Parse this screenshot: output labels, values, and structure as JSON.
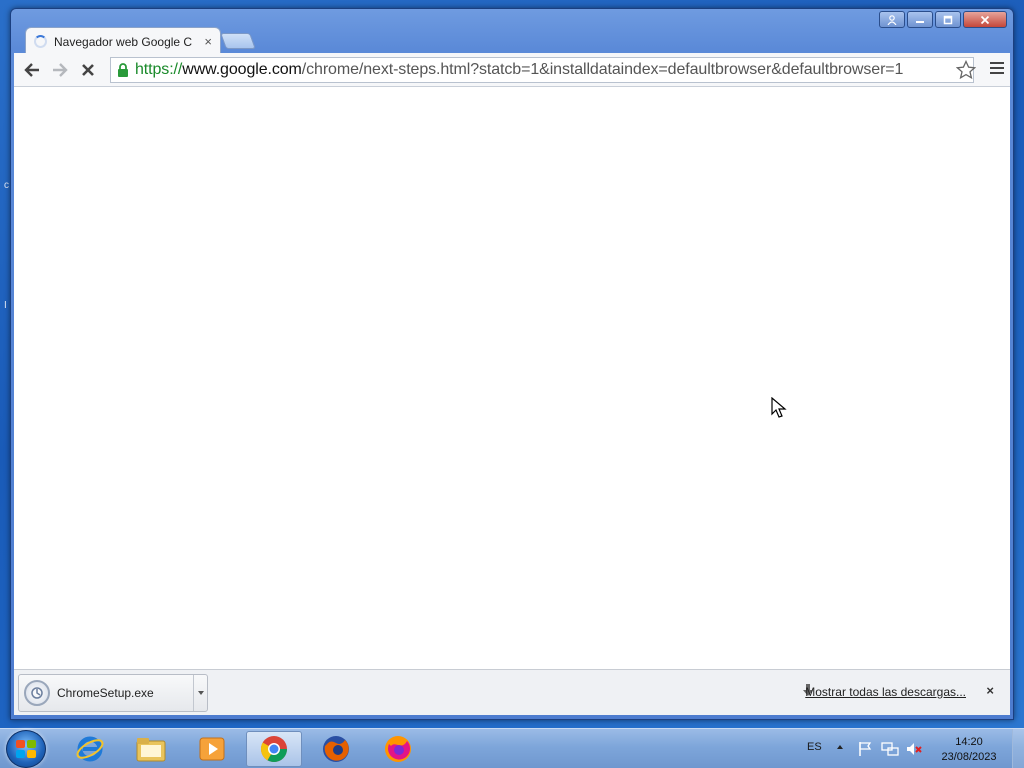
{
  "desktop": {
    "glyph_top": "c",
    "glyph_mid": "I"
  },
  "window": {
    "controls": {
      "profile_icon": "profile-icon",
      "minimize": "–",
      "maximize": "□",
      "close": "x"
    }
  },
  "tab": {
    "title": "Navegador web Google C",
    "close": "×"
  },
  "toolbar": {
    "url_scheme": "https://",
    "url_host": "www.google.com",
    "url_path": "/chrome/next-steps.html?statcb=1&installdataindex=defaultbrowser&defaultbrowser=1"
  },
  "downloads": {
    "file_name": "ChromeSetup.exe",
    "show_all": "Mostrar todas las descargas...",
    "close": "×"
  },
  "taskbar": {
    "apps": [
      "internet-explorer",
      "file-explorer",
      "media-player",
      "chrome",
      "firefox",
      "firefox-alt"
    ],
    "language": "ES",
    "time": "14:20",
    "date": "23/08/2023"
  }
}
